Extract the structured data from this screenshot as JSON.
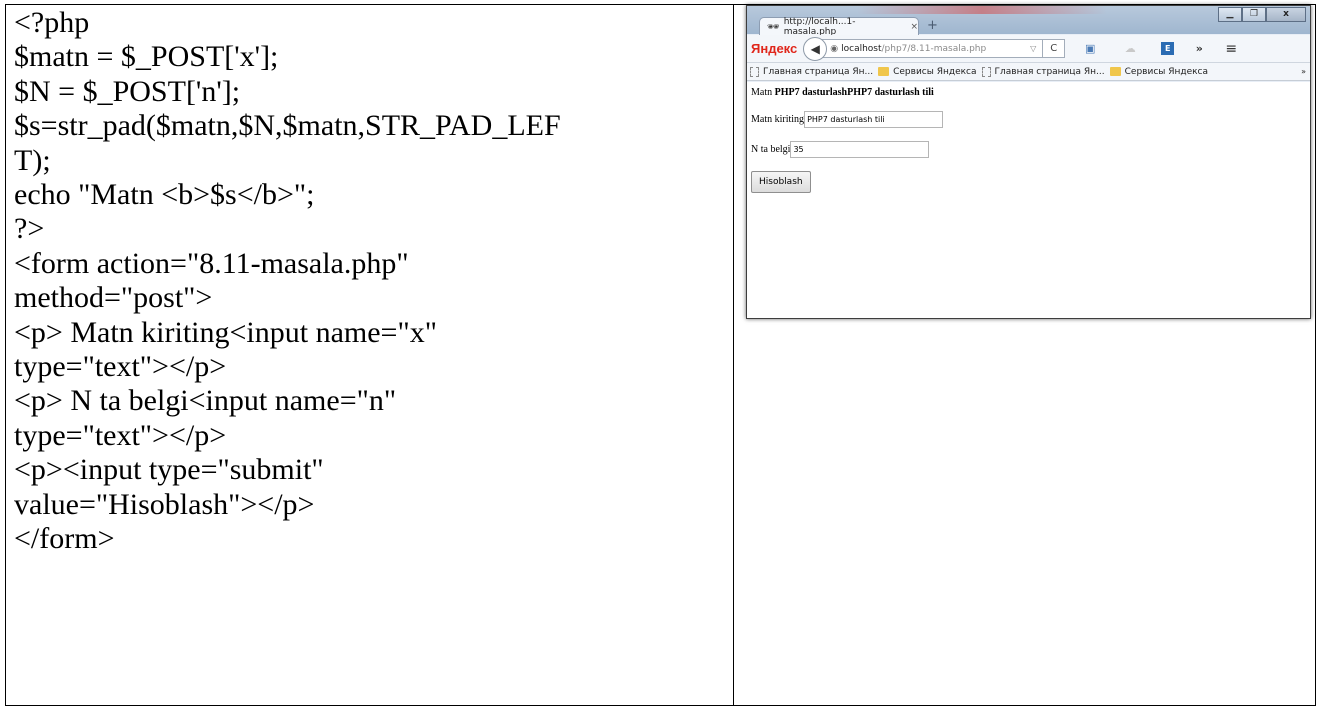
{
  "code_lines": [
    "<?php",
    "$matn = $_POST['x'];",
    "$N = $_POST['n'];",
    "$s=str_pad($matn,$N,$matn,STR_PAD_LEF",
    "T);",
    "echo \"Matn <b>$s</b>\";",
    "?>",
    "<form action=\"8.11-masala.php\"",
    "method=\"post\">",
    "<p> Matn kiriting<input name=\"x\"",
    "type=\"text\"></p>",
    "<p> N ta belgi<input name=\"n\"",
    "type=\"text\"></p>",
    "<p><input type=\"submit\"",
    "value=\"Hisoblash\"></p>",
    "</form>"
  ],
  "browser": {
    "tab_title": "http://localh...1-masala.php",
    "tab_close": "×",
    "new_tab": "+",
    "yandex_label": "Яндекс",
    "url_host": "localhost",
    "url_path": "/php7/8.11-masala.php",
    "bookmarks": [
      {
        "label": "Главная страница Ян...",
        "icon": "page-icon"
      },
      {
        "label": "Сервисы Яндекса",
        "icon": "folder-icon"
      },
      {
        "label": "Главная страница Ян...",
        "icon": "page-icon"
      },
      {
        "label": "Сервисы Яндекса",
        "icon": "folder-icon"
      }
    ],
    "bookmarks_more": "»",
    "nav_more": "»"
  },
  "page": {
    "output_prefix": "Matn ",
    "output_bold": "PHP7 dasturlashPHP7 dasturlash tili",
    "matn_label": "Matn kiriting",
    "matn_value": "PHP7 dasturlash tili",
    "n_label": "N ta belgi",
    "n_value": "35",
    "submit_label": "Hisoblash"
  }
}
